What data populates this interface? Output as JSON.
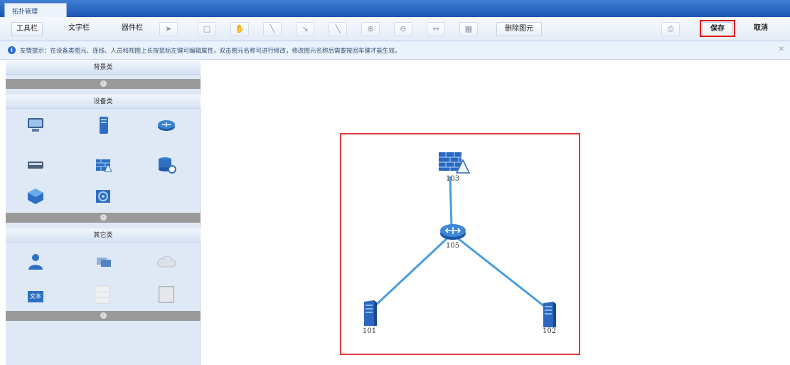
{
  "tab": {
    "label": "拓扑管理"
  },
  "toolbar": {
    "tool_bar": "工具栏",
    "text_bar": "文字栏",
    "component_bar": "器件栏",
    "delete_element": "删除图元",
    "save": "保存",
    "cancel": "取消"
  },
  "hint": {
    "text": "友情提示：在设备类图元、连线、人员和视图上长按鼠标左键可编辑属性，双击图元名称可进行修改，修改图元名称后需要按回车键才能生效。"
  },
  "panel": {
    "background_section": "背景类",
    "device_section": "设备类",
    "other_section": "其它类",
    "text_tile": "文本"
  },
  "topology": {
    "nodes": [
      {
        "id": "103",
        "type": "firewall-icon"
      },
      {
        "id": "105",
        "type": "router-icon"
      },
      {
        "id": "101",
        "type": "server-icon"
      },
      {
        "id": "102",
        "type": "server-icon"
      }
    ],
    "links": [
      [
        "103",
        "105"
      ],
      [
        "105",
        "101"
      ],
      [
        "105",
        "102"
      ]
    ]
  },
  "colors": {
    "accent": "#1b55b2",
    "highlight": "#e01818",
    "link": "#4a9de0"
  }
}
